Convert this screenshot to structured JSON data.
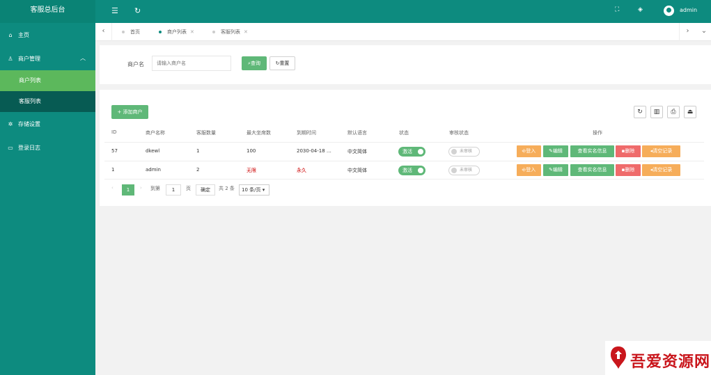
{
  "sidebar": {
    "brand": "客服总后台",
    "home": "主页",
    "merchant_mgmt": "商户管理",
    "merchant_list": "商户列表",
    "agent_list": "客服列表",
    "storage": "存储设置",
    "login_log": "登录日志"
  },
  "header": {
    "username": "admin"
  },
  "tabs": [
    {
      "label": "首页"
    },
    {
      "label": "商户列表"
    },
    {
      "label": "客服列表"
    }
  ],
  "search": {
    "label": "商户名",
    "placeholder": "请输入商户名",
    "query_button": "查询",
    "reset_button": "重置"
  },
  "table": {
    "add_button": "添加商户",
    "columns": [
      "ID",
      "商户名称",
      "客服数量",
      "最大坐席数",
      "到期时间",
      "默认语言",
      "状态",
      "审核状态",
      "操作"
    ],
    "rows": [
      {
        "id": "57",
        "name": "dkewl",
        "agents": "1",
        "max_seats": "100",
        "expire": "2030-04-18 …",
        "lang": "中文简体",
        "status": "激活",
        "review": "未审核"
      },
      {
        "id": "1",
        "name": "admin",
        "agents": "2",
        "max_seats": "无限",
        "expire": "永久",
        "lang": "中文简体",
        "status": "激活",
        "review": "未审核"
      }
    ],
    "actions": {
      "login": "登入",
      "edit": "编辑",
      "realname": "查看实名信息",
      "delete": "删除",
      "clear": "清空记录"
    }
  },
  "pager": {
    "current": "1",
    "goto_label": "到第",
    "goto_value": "1",
    "page_unit": "页",
    "confirm": "确定",
    "total": "共 2 条",
    "page_size": "10 条/页"
  },
  "watermark": {
    "text": "吾爱资源网"
  },
  "colors": {
    "primary": "#0d8b7f",
    "green": "#5fb878",
    "orange": "#f6ad5a",
    "red": "#ef6b6b"
  }
}
